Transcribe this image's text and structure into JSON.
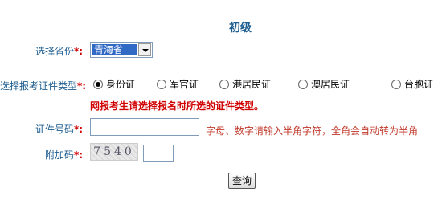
{
  "form": {
    "title": "初级",
    "province": {
      "label": "选择省份",
      "required_mark": "*:",
      "selected": "青海省"
    },
    "id_type": {
      "label": "选择报考证件类型",
      "required_mark": "*:",
      "options": [
        "身份证",
        "军官证",
        "港居民证",
        "澳居民证",
        "台胞证"
      ],
      "selected_index": 0
    },
    "warning": "网报考生请选择报名时所选的证件类型。",
    "id_number": {
      "label": "证件号码",
      "required_mark": "*:",
      "value": "",
      "hint": "字母、数字请输入半角字符，全角会自动转为半角"
    },
    "captcha": {
      "label": "附加码",
      "required_mark": "*:",
      "image_text": "7540",
      "value": ""
    },
    "submit_label": "查询"
  }
}
